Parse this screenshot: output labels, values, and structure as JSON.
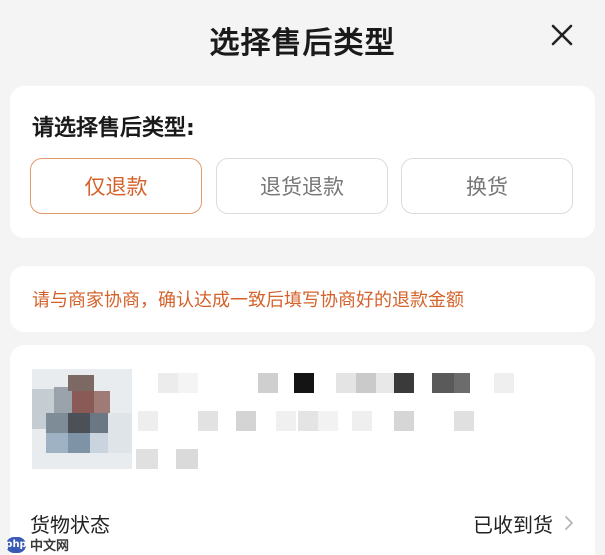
{
  "header": {
    "title": "选择售后类型",
    "close_icon": "close-icon"
  },
  "type_section": {
    "heading": "请选择售后类型:",
    "options": [
      {
        "label": "仅退款",
        "selected": true
      },
      {
        "label": "退货退款",
        "selected": false
      },
      {
        "label": "换货",
        "selected": false
      }
    ]
  },
  "notice": {
    "text": "请与商家协商，确认达成一致后填写协商好的退款金额"
  },
  "product": {
    "status_label": "货物状态",
    "status_value": "已收到货",
    "chevron_icon": "chevron-right-icon"
  },
  "watermark": {
    "logo": "php",
    "text": "中文网"
  },
  "colors": {
    "accent": "#d4622a",
    "accent_border": "#e39a6b",
    "background": "#f4f4f4",
    "card": "#ffffff"
  }
}
